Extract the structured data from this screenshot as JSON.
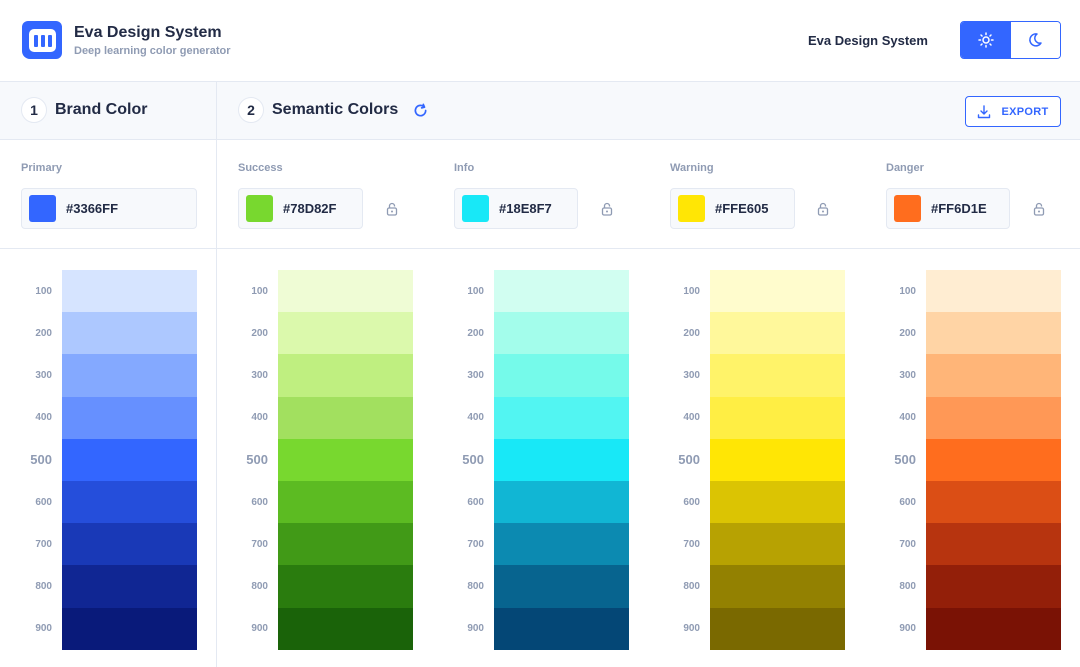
{
  "header": {
    "title": "Eva Design System",
    "subtitle": "Deep learning color generator",
    "link": "Eva Design System",
    "theme": {
      "light_icon": "sun-icon",
      "dark_icon": "moon-icon",
      "active": "light"
    }
  },
  "sections": {
    "brand": {
      "number": "1",
      "label": "Brand Color"
    },
    "semantic": {
      "number": "2",
      "label": "Semantic Colors",
      "refresh_icon": "refresh-icon"
    },
    "export_label": "EXPORT"
  },
  "colors": [
    {
      "key": "primary",
      "label": "Primary",
      "hex": "#3366FF",
      "lockable": false,
      "shades": [
        {
          "level": "100",
          "color": "#D6E4FF"
        },
        {
          "level": "200",
          "color": "#ADC8FF"
        },
        {
          "level": "300",
          "color": "#84A9FF"
        },
        {
          "level": "400",
          "color": "#6690FF"
        },
        {
          "level": "500",
          "color": "#3366FF"
        },
        {
          "level": "600",
          "color": "#254EDB"
        },
        {
          "level": "700",
          "color": "#1939B7"
        },
        {
          "level": "800",
          "color": "#102693"
        },
        {
          "level": "900",
          "color": "#091A7A"
        }
      ]
    },
    {
      "key": "success",
      "label": "Success",
      "hex": "#78D82F",
      "lockable": true,
      "shades": [
        {
          "level": "100",
          "color": "#EFFCD5"
        },
        {
          "level": "200",
          "color": "#DBF9AC"
        },
        {
          "level": "300",
          "color": "#BFEF80"
        },
        {
          "level": "400",
          "color": "#A2E05F"
        },
        {
          "level": "500",
          "color": "#78D82F"
        },
        {
          "level": "600",
          "color": "#5CBB22"
        },
        {
          "level": "700",
          "color": "#419A17"
        },
        {
          "level": "800",
          "color": "#2A7C0E"
        },
        {
          "level": "900",
          "color": "#1A6309"
        }
      ]
    },
    {
      "key": "info",
      "label": "Info",
      "hex": "#18E8F7",
      "lockable": true,
      "shades": [
        {
          "level": "100",
          "color": "#D1FEF1"
        },
        {
          "level": "200",
          "color": "#A3FDEB"
        },
        {
          "level": "300",
          "color": "#75FAEA"
        },
        {
          "level": "400",
          "color": "#52F5F2"
        },
        {
          "level": "500",
          "color": "#18E8F7"
        },
        {
          "level": "600",
          "color": "#11B6D4"
        },
        {
          "level": "700",
          "color": "#0C8AB1"
        },
        {
          "level": "800",
          "color": "#07648F"
        },
        {
          "level": "900",
          "color": "#044776"
        }
      ]
    },
    {
      "key": "warning",
      "label": "Warning",
      "hex": "#FFE605",
      "lockable": true,
      "shades": [
        {
          "level": "100",
          "color": "#FFFCCD"
        },
        {
          "level": "200",
          "color": "#FFF89B"
        },
        {
          "level": "300",
          "color": "#FFF369"
        },
        {
          "level": "400",
          "color": "#FFEE44"
        },
        {
          "level": "500",
          "color": "#FFE605"
        },
        {
          "level": "600",
          "color": "#DBC403"
        },
        {
          "level": "700",
          "color": "#B7A202"
        },
        {
          "level": "800",
          "color": "#938101"
        },
        {
          "level": "900",
          "color": "#7A6900"
        }
      ]
    },
    {
      "key": "danger",
      "label": "Danger",
      "hex": "#FF6D1E",
      "lockable": true,
      "shades": [
        {
          "level": "100",
          "color": "#FFEDD2"
        },
        {
          "level": "200",
          "color": "#FFD4A5"
        },
        {
          "level": "300",
          "color": "#FFB578"
        },
        {
          "level": "400",
          "color": "#FF9856"
        },
        {
          "level": "500",
          "color": "#FF6D1E"
        },
        {
          "level": "600",
          "color": "#DB4E15"
        },
        {
          "level": "700",
          "color": "#B7340F"
        },
        {
          "level": "800",
          "color": "#931F09"
        },
        {
          "level": "900",
          "color": "#7A1205"
        }
      ]
    }
  ]
}
